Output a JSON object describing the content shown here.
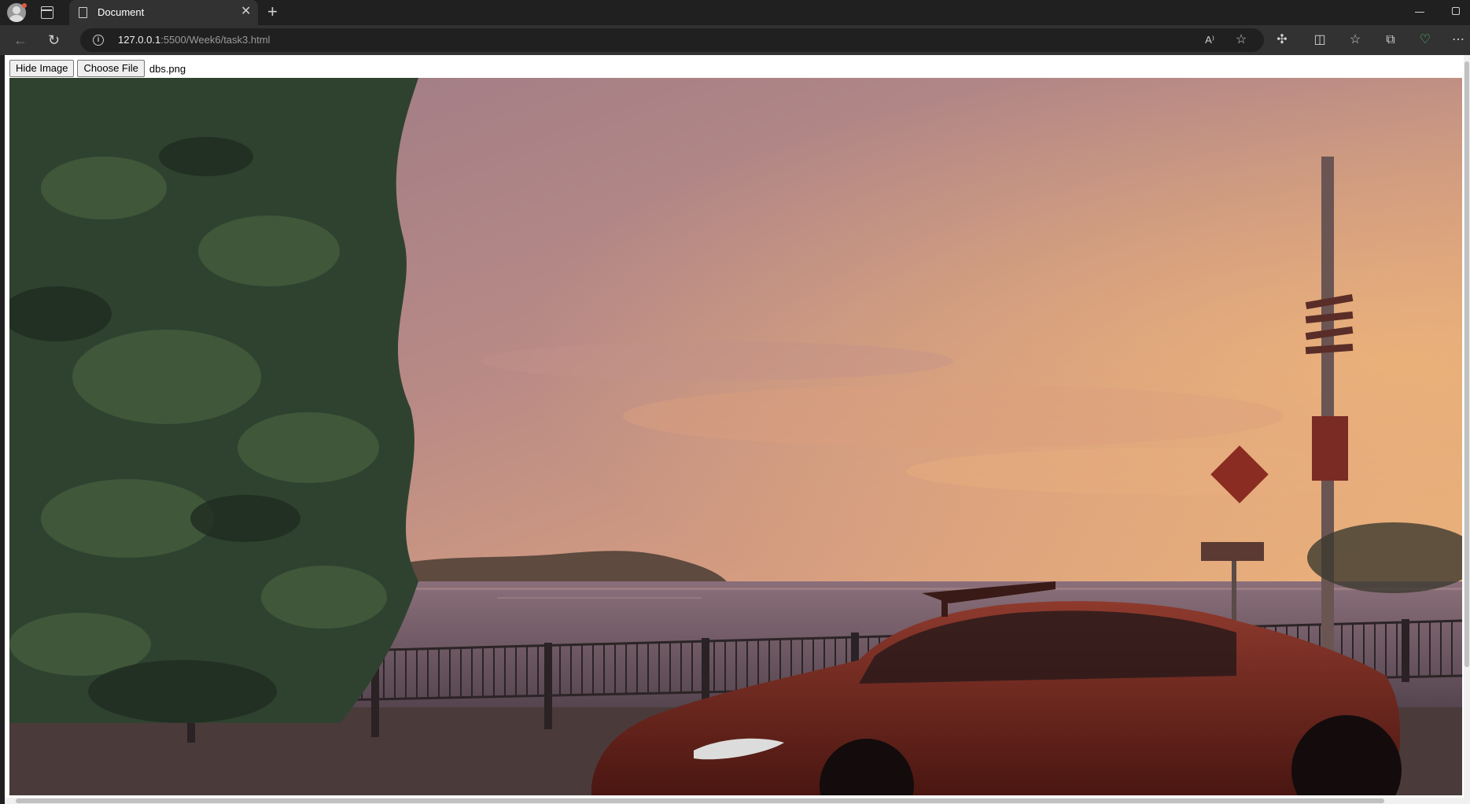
{
  "browser": {
    "tab_title": "Document",
    "url_host": "127.0.0.1",
    "url_rest": ":5500/Week6/task3.html",
    "icons": [
      "profile-icon",
      "tab-actions-icon",
      "document-icon",
      "close-icon",
      "new-tab-icon",
      "minimize-icon",
      "restore-icon",
      "back-icon",
      "refresh-icon",
      "site-info-icon",
      "read-aloud-icon",
      "favorite-icon",
      "extensions-icon",
      "split-screen-icon",
      "favorites-icon",
      "collections-icon",
      "browser-essentials-icon",
      "more-icon"
    ]
  },
  "page": {
    "hide_button": "Hide Image",
    "choose_file_button": "Choose File",
    "file_name": "dbs.png"
  },
  "photo": {
    "description_colors": {
      "sky_top": "#9f7d86",
      "sky_mid": "#c99484",
      "sky_horizon": "#e6a877",
      "sea": "#6f5a66",
      "foliage": "#2f4230",
      "car": "#7a2820"
    }
  }
}
